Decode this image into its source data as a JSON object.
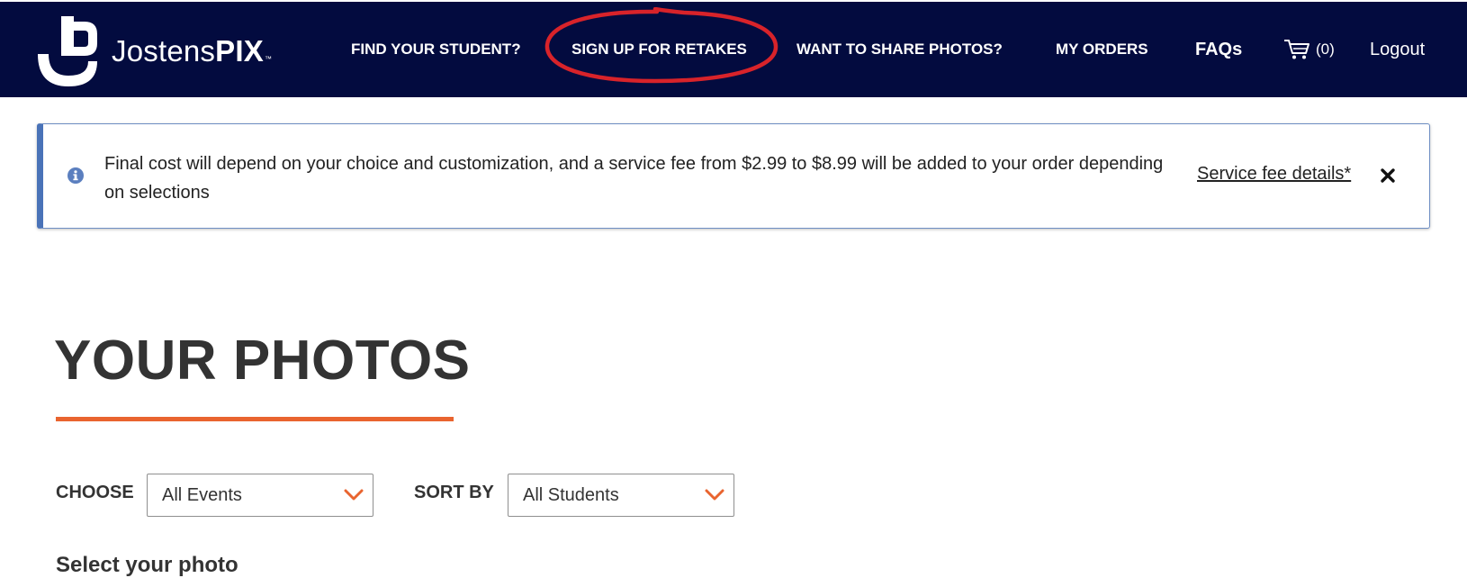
{
  "colors": {
    "navbar_bg": "#030b3f",
    "accent_orange": "#e9642f",
    "notice_border": "#4a73b8",
    "annotation_red": "#d8232a"
  },
  "header": {
    "brand_light": "Jostens",
    "brand_bold": "PIX",
    "brand_tm": "™",
    "logo_icon": "jostens-j-logo-icon",
    "nav": {
      "find_student": "FIND YOUR STUDENT?",
      "sign_up_retakes": "SIGN UP FOR RETAKES",
      "share_photos": "WANT TO SHARE PHOTOS?",
      "my_orders": "MY ORDERS",
      "faqs": "FAQs",
      "cart_count": "(0)",
      "cart_icon": "shopping-cart-icon",
      "logout": "Logout"
    }
  },
  "notice": {
    "icon": "info-icon",
    "message": "Final cost will depend on your choice and customization, and a service fee from $2.99 to $8.99 will be added to your order depending on selections",
    "link": "Service fee details*",
    "close_icon": "close-icon"
  },
  "main": {
    "title": "YOUR PHOTOS",
    "filters": {
      "choose_label": "CHOOSE",
      "choose_value": "All Events",
      "sort_label": "SORT BY",
      "sort_value": "All Students"
    },
    "section_heading": "Select your photo"
  }
}
